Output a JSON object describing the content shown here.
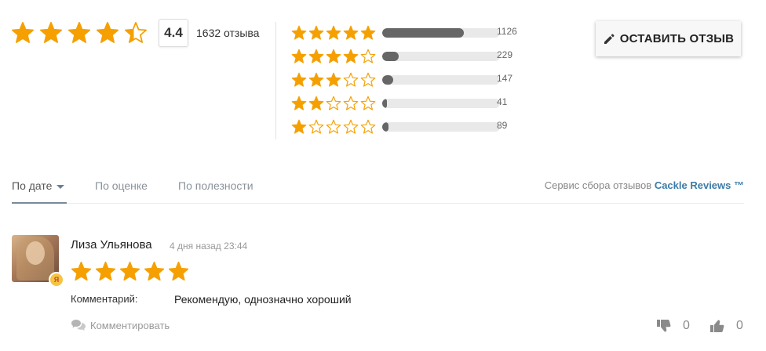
{
  "summary": {
    "rating": "4.4",
    "rating_value": 4.4,
    "review_count": "1632 отзыва"
  },
  "distribution": [
    {
      "stars": 5,
      "count": "1126",
      "fraction": 0.69
    },
    {
      "stars": 4,
      "count": "229",
      "fraction": 0.14
    },
    {
      "stars": 3,
      "count": "147",
      "fraction": 0.09
    },
    {
      "stars": 2,
      "count": "41",
      "fraction": 0.025
    },
    {
      "stars": 1,
      "count": "89",
      "fraction": 0.055
    }
  ],
  "leave_review": {
    "label": "ОСТАВИТЬ ОТЗЫВ",
    "icon": "pencil-icon"
  },
  "tabs": [
    {
      "label": "По дате",
      "active": true
    },
    {
      "label": "По оценке",
      "active": false
    },
    {
      "label": "По полезности",
      "active": false
    }
  ],
  "service": {
    "prefix": "Сервис сбора отзывов",
    "link": "Cackle Reviews ™"
  },
  "review": {
    "author": "Лиза Ульянова",
    "date": "4 дня назад 23:44",
    "stars": 5,
    "comment_label": "Комментарий:",
    "comment_text": "Рекомендую, однозначно хороший",
    "badge": "Я",
    "comment_action": "Комментировать",
    "dislikes": "0",
    "likes": "0"
  },
  "colors": {
    "star": "#f5a000",
    "bar_fill": "#666666",
    "bar_track": "#e9e9e9",
    "link": "#3a7ca8"
  }
}
